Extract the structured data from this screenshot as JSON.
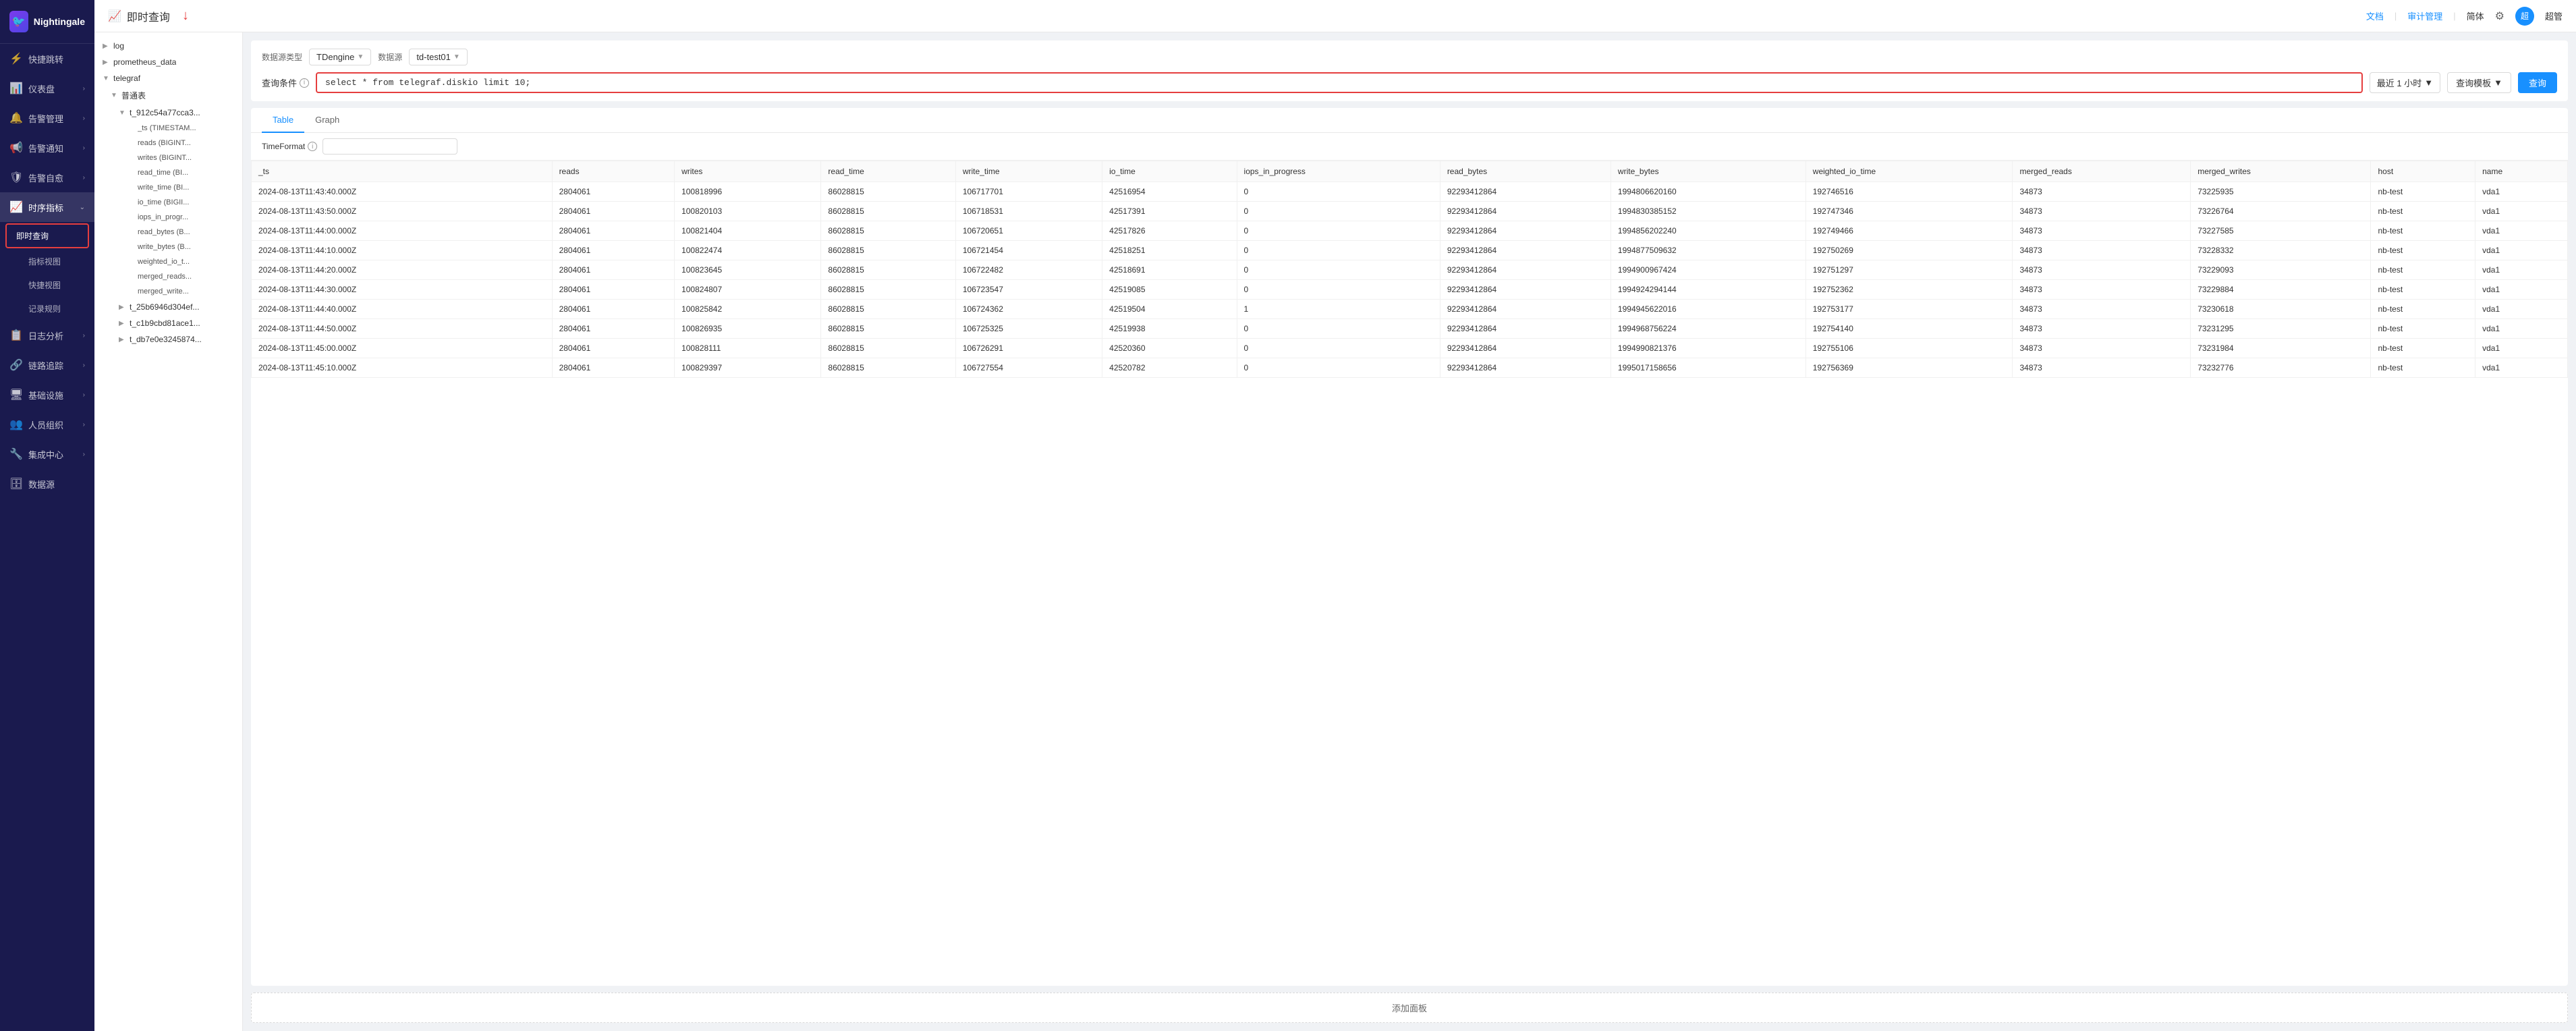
{
  "app": {
    "name": "Nightingale",
    "logo_text": "Nightingale"
  },
  "topbar": {
    "title": "即时查询",
    "title_icon": "📈",
    "links": [
      "文档",
      "审计管理",
      "简体"
    ],
    "username": "超管"
  },
  "sidebar": {
    "items": [
      {
        "id": "quick-jump",
        "label": "快捷跳转",
        "icon": "⚡",
        "has_arrow": false
      },
      {
        "id": "dashboard",
        "label": "仪表盘",
        "icon": "📊",
        "has_arrow": true
      },
      {
        "id": "alert-mgmt",
        "label": "告警管理",
        "icon": "🔔",
        "has_arrow": true
      },
      {
        "id": "alert-notify",
        "label": "告警通知",
        "icon": "📢",
        "has_arrow": true
      },
      {
        "id": "alert-self",
        "label": "告警自愈",
        "icon": "🛡",
        "has_arrow": true
      },
      {
        "id": "time-series",
        "label": "时序指标",
        "icon": "📈",
        "has_arrow": true,
        "active": true
      },
      {
        "id": "instant-query",
        "label": "即时查询",
        "icon": "",
        "has_arrow": false,
        "subitem": true,
        "highlighted": true
      },
      {
        "id": "metric-view",
        "label": "指标视图",
        "icon": "",
        "has_arrow": false,
        "subitem": true
      },
      {
        "id": "quick-view",
        "label": "快捷视图",
        "icon": "",
        "has_arrow": false,
        "subitem": true
      },
      {
        "id": "record-rule",
        "label": "记录规则",
        "icon": "",
        "has_arrow": false,
        "subitem": true
      },
      {
        "id": "log-analysis",
        "label": "日志分析",
        "icon": "📋",
        "has_arrow": true
      },
      {
        "id": "trace",
        "label": "链路追踪",
        "icon": "🔗",
        "has_arrow": true
      },
      {
        "id": "infra",
        "label": "基础设施",
        "icon": "🖥",
        "has_arrow": true
      },
      {
        "id": "people",
        "label": "人员组织",
        "icon": "👥",
        "has_arrow": true
      },
      {
        "id": "integration",
        "label": "集成中心",
        "icon": "🔧",
        "has_arrow": true
      },
      {
        "id": "datasource",
        "label": "数据源",
        "icon": "🗄",
        "has_arrow": false
      }
    ]
  },
  "datasource": {
    "type_label": "数据源类型",
    "type_value": "TDengine",
    "source_label": "数据源",
    "source_value": "td-test01"
  },
  "query": {
    "label": "查询条件",
    "placeholder": "select * from telegraf.diskio limit 10;",
    "value": "select * from telegraf.diskio limit 10;",
    "time_range": "最近 1 小时",
    "template_btn": "查询模板",
    "submit_btn": "查询"
  },
  "tabs": [
    {
      "id": "table",
      "label": "Table",
      "active": true
    },
    {
      "id": "graph",
      "label": "Graph",
      "active": false
    }
  ],
  "timeformat": {
    "label": "TimeFormat",
    "value": ""
  },
  "tree": {
    "items": [
      {
        "level": 0,
        "label": "log",
        "arrow": "▶",
        "collapsed": true
      },
      {
        "level": 0,
        "label": "prometheus_data",
        "arrow": "▶",
        "collapsed": true
      },
      {
        "level": 0,
        "label": "telegraf",
        "arrow": "▼",
        "collapsed": false
      },
      {
        "level": 1,
        "label": "普通表",
        "arrow": "▼",
        "collapsed": false
      },
      {
        "level": 2,
        "label": "t_912c54a77cca3...",
        "arrow": "▼",
        "collapsed": false
      },
      {
        "level": 3,
        "label": "_ts (TIMESTAM...",
        "arrow": "",
        "leaf": true
      },
      {
        "level": 3,
        "label": "reads (BIGINT...",
        "arrow": "",
        "leaf": true
      },
      {
        "level": 3,
        "label": "writes (BIGINT...",
        "arrow": "",
        "leaf": true
      },
      {
        "level": 3,
        "label": "read_time (BI...",
        "arrow": "",
        "leaf": true
      },
      {
        "level": 3,
        "label": "write_time (BI...",
        "arrow": "",
        "leaf": true
      },
      {
        "level": 3,
        "label": "io_time (BIGII...",
        "arrow": "",
        "leaf": true
      },
      {
        "level": 3,
        "label": "iops_in_progr...",
        "arrow": "",
        "leaf": true
      },
      {
        "level": 3,
        "label": "read_bytes (B...",
        "arrow": "",
        "leaf": true
      },
      {
        "level": 3,
        "label": "write_bytes (B...",
        "arrow": "",
        "leaf": true
      },
      {
        "level": 3,
        "label": "weighted_io_t...",
        "arrow": "",
        "leaf": true
      },
      {
        "level": 3,
        "label": "merged_reads...",
        "arrow": "",
        "leaf": true
      },
      {
        "level": 3,
        "label": "merged_write...",
        "arrow": "",
        "leaf": true
      },
      {
        "level": 2,
        "label": "t_25b6946d304ef...",
        "arrow": "▶",
        "collapsed": true
      },
      {
        "level": 2,
        "label": "t_c1b9cbd81ace1...",
        "arrow": "▶",
        "collapsed": true
      },
      {
        "level": 2,
        "label": "t_db7e0e3245874...",
        "arrow": "▶",
        "collapsed": true
      }
    ]
  },
  "table": {
    "columns": [
      "_ts",
      "reads",
      "writes",
      "read_time",
      "write_time",
      "io_time",
      "iops_in_progress",
      "read_bytes",
      "write_bytes",
      "weighted_io_time",
      "merged_reads",
      "merged_writes",
      "host",
      "name"
    ],
    "rows": [
      [
        "2024-08-13T11:43:40.000Z",
        "2804061",
        "100818996",
        "86028815",
        "106717701",
        "42516954",
        "0",
        "92293412864",
        "1994806620160",
        "192746516",
        "34873",
        "73225935",
        "nb-test",
        "vda1"
      ],
      [
        "2024-08-13T11:43:50.000Z",
        "2804061",
        "100820103",
        "86028815",
        "106718531",
        "42517391",
        "0",
        "92293412864",
        "1994830385152",
        "192747346",
        "34873",
        "73226764",
        "nb-test",
        "vda1"
      ],
      [
        "2024-08-13T11:44:00.000Z",
        "2804061",
        "100821404",
        "86028815",
        "106720651",
        "42517826",
        "0",
        "92293412864",
        "1994856202240",
        "192749466",
        "34873",
        "73227585",
        "nb-test",
        "vda1"
      ],
      [
        "2024-08-13T11:44:10.000Z",
        "2804061",
        "100822474",
        "86028815",
        "106721454",
        "42518251",
        "0",
        "92293412864",
        "1994877509632",
        "192750269",
        "34873",
        "73228332",
        "nb-test",
        "vda1"
      ],
      [
        "2024-08-13T11:44:20.000Z",
        "2804061",
        "100823645",
        "86028815",
        "106722482",
        "42518691",
        "0",
        "92293412864",
        "1994900967424",
        "192751297",
        "34873",
        "73229093",
        "nb-test",
        "vda1"
      ],
      [
        "2024-08-13T11:44:30.000Z",
        "2804061",
        "100824807",
        "86028815",
        "106723547",
        "42519085",
        "0",
        "92293412864",
        "1994924294144",
        "192752362",
        "34873",
        "73229884",
        "nb-test",
        "vda1"
      ],
      [
        "2024-08-13T11:44:40.000Z",
        "2804061",
        "100825842",
        "86028815",
        "106724362",
        "42519504",
        "1",
        "92293412864",
        "1994945622016",
        "192753177",
        "34873",
        "73230618",
        "nb-test",
        "vda1"
      ],
      [
        "2024-08-13T11:44:50.000Z",
        "2804061",
        "100826935",
        "86028815",
        "106725325",
        "42519938",
        "0",
        "92293412864",
        "1994968756224",
        "192754140",
        "34873",
        "73231295",
        "nb-test",
        "vda1"
      ],
      [
        "2024-08-13T11:45:00.000Z",
        "2804061",
        "100828111",
        "86028815",
        "106726291",
        "42520360",
        "0",
        "92293412864",
        "1994990821376",
        "192755106",
        "34873",
        "73231984",
        "nb-test",
        "vda1"
      ],
      [
        "2024-08-13T11:45:10.000Z",
        "2804061",
        "100829397",
        "86028815",
        "106727554",
        "42520782",
        "0",
        "92293412864",
        "1995017158656",
        "192756369",
        "34873",
        "73232776",
        "nb-test",
        "vda1"
      ]
    ]
  },
  "add_panel": {
    "label": "添加面板"
  }
}
